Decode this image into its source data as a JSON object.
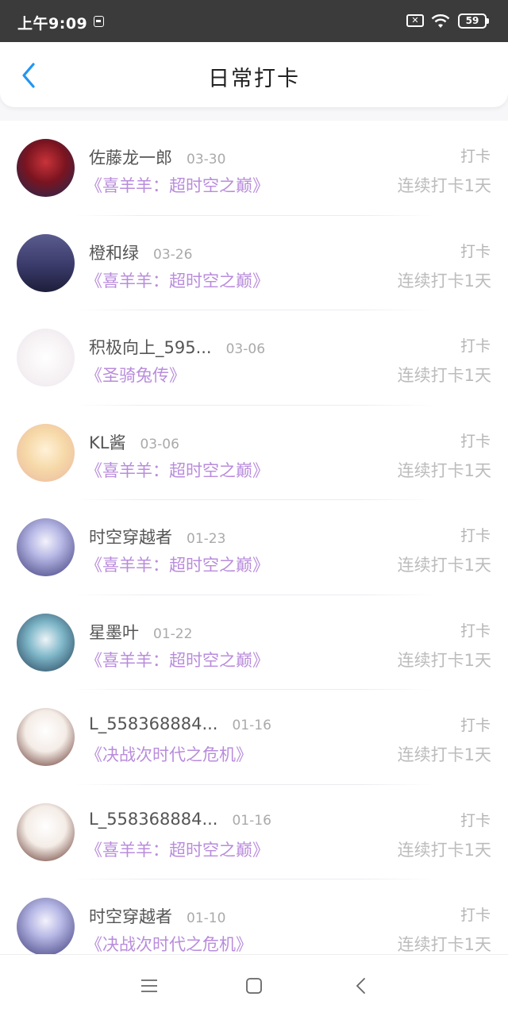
{
  "status_bar": {
    "time": "上午9:09",
    "battery": "59",
    "sim_icon": "sim-off-icon",
    "wifi_icon": "wifi-icon"
  },
  "header": {
    "title": "日常打卡",
    "back_icon": "chevron-left-icon",
    "accent": "#2196f3"
  },
  "colors": {
    "book": "#b98cdc",
    "muted": "#b5b5b5"
  },
  "checkins": [
    {
      "name": "佐藤龙一郎",
      "date": "03-30",
      "book": "《喜羊羊：超时空之巅》",
      "tag": "打卡",
      "streak": "连续打卡1天",
      "avatar": "red-character-avatar"
    },
    {
      "name": "橙和绿",
      "date": "03-26",
      "book": "《喜羊羊：超时空之巅》",
      "tag": "打卡",
      "streak": "连续打卡1天",
      "avatar": "night-sky-avatar"
    },
    {
      "name": "积极向上_595...",
      "date": "03-06",
      "book": "《圣骑兔传》",
      "tag": "打卡",
      "streak": "连续打卡1天",
      "avatar": "rabbit-avatar"
    },
    {
      "name": "KL酱",
      "date": "03-06",
      "book": "《喜羊羊：超时空之巅》",
      "tag": "打卡",
      "streak": "连续打卡1天",
      "avatar": "blonde-girl-avatar"
    },
    {
      "name": "时空穿越者",
      "date": "01-23",
      "book": "《喜羊羊：超时空之巅》",
      "tag": "打卡",
      "streak": "连续打卡1天",
      "avatar": "sheep-avatar"
    },
    {
      "name": "星墨叶",
      "date": "01-22",
      "book": "《喜羊羊：超时空之巅》",
      "tag": "打卡",
      "streak": "连续打卡1天",
      "avatar": "dark-hair-boy-avatar"
    },
    {
      "name": "L_558368884...",
      "date": "01-16",
      "book": "《决战次时代之危机》",
      "tag": "打卡",
      "streak": "连续打卡1天",
      "avatar": "girl-with-sheep-avatar"
    },
    {
      "name": "L_558368884...",
      "date": "01-16",
      "book": "《喜羊羊：超时空之巅》",
      "tag": "打卡",
      "streak": "连续打卡1天",
      "avatar": "girl-with-sheep-avatar"
    },
    {
      "name": "时空穿越者",
      "date": "01-10",
      "book": "《决战次时代之危机》",
      "tag": "打卡",
      "streak": "连续打卡1天",
      "avatar": "sheep-avatar"
    }
  ],
  "system_nav": {
    "menu_icon": "menu-icon",
    "home_icon": "home-square-icon",
    "back_icon": "back-triangle-icon"
  }
}
